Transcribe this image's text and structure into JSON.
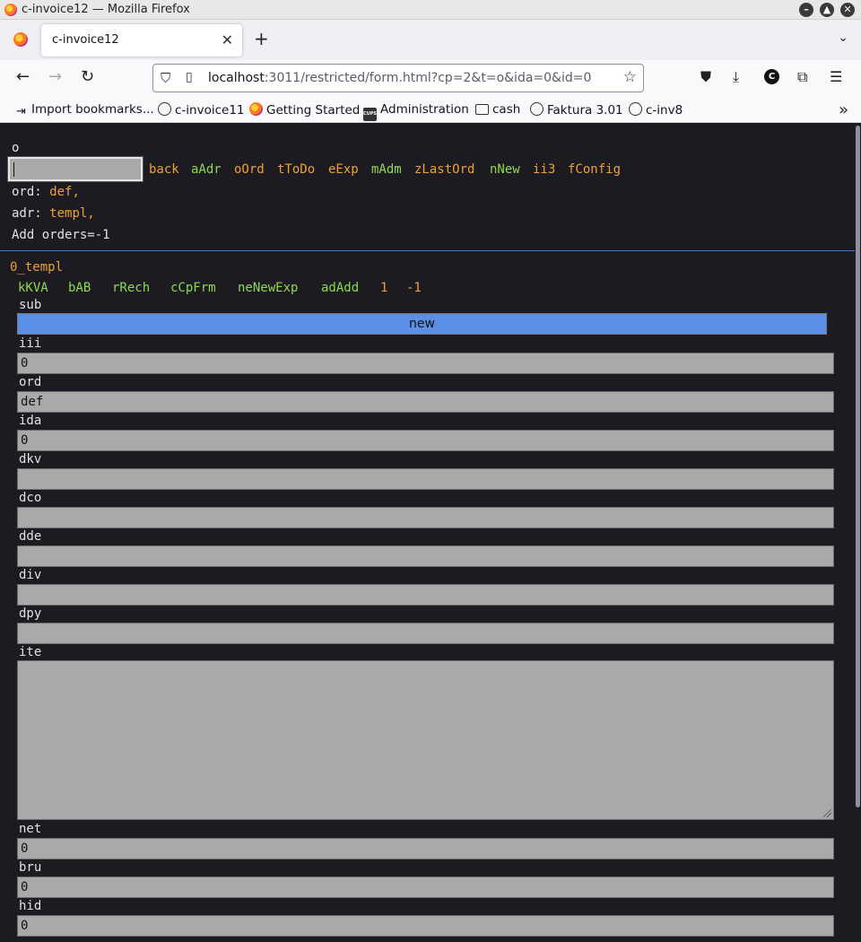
{
  "window": {
    "title": "c-invoice12 — Mozilla Firefox",
    "controls": [
      "minimize",
      "maximize",
      "close"
    ]
  },
  "tabs": {
    "active_title": "c-invoice12",
    "new_tab": "+",
    "list_all": "⌄"
  },
  "nav": {
    "url_host": "localhost",
    "url_rest": ":3011/restricted/form.html?cp=2&t=o&ida=0&id=0",
    "account_initial": "C"
  },
  "bookmarks": [
    {
      "label": "Import bookmarks...",
      "icon": "import-icon"
    },
    {
      "label": "c-invoice11",
      "icon": "globe-icon"
    },
    {
      "label": "Getting Started",
      "icon": "firefox-icon"
    },
    {
      "label": "Administration",
      "icon": "cups-icon"
    },
    {
      "label": "cash",
      "icon": "folder-icon"
    },
    {
      "label": "Faktura 3.01",
      "icon": "globe-icon"
    },
    {
      "label": "c-inv8",
      "icon": "globe-icon"
    }
  ],
  "page": {
    "mode": "o",
    "command_value": "",
    "nav_links": [
      {
        "label": "back",
        "color": "#f0a030"
      },
      {
        "label": "aAdr",
        "color": "#8fd94a"
      },
      {
        "label": "oOrd",
        "color": "#f0a030"
      },
      {
        "label": "tToDo",
        "color": "#f0a030"
      },
      {
        "label": "eExp",
        "color": "#f0a030"
      },
      {
        "label": "mAdm",
        "color": "#8fd94a"
      },
      {
        "label": "zLastOrd",
        "color": "#f0a030"
      },
      {
        "label": "nNew",
        "color": "#8fd94a"
      },
      {
        "label": "ii3",
        "color": "#f0a030"
      },
      {
        "label": "fConfig",
        "color": "#f0a030"
      }
    ],
    "ord_label": "ord:",
    "ord_value": "def,",
    "adr_label": "adr:",
    "adr_value": "templ,",
    "add_orders": "Add orders=-1",
    "record_title": "0_templ",
    "sub_links": [
      {
        "label": "kKVA",
        "color": "#8fd94a"
      },
      {
        "label": "bAB",
        "color": "#8fd94a"
      },
      {
        "label": "rRech",
        "color": "#8fd94a"
      },
      {
        "label": "cCpFrm",
        "color": "#8fd94a"
      },
      {
        "label": "neNewExp",
        "color": "#8fd94a"
      },
      {
        "label": "adAdd",
        "color": "#8fd94a"
      },
      {
        "label": "1",
        "color": "#f0a030"
      },
      {
        "label": "-1",
        "color": "#f0a030"
      }
    ],
    "form": {
      "sub_label": "sub",
      "sub_button": "new",
      "fields": [
        {
          "label": "iii",
          "value": "0"
        },
        {
          "label": "ord",
          "value": "def"
        },
        {
          "label": "ida",
          "value": "0"
        },
        {
          "label": "dkv",
          "value": ""
        },
        {
          "label": "dco",
          "value": ""
        },
        {
          "label": "dde",
          "value": ""
        },
        {
          "label": "div",
          "value": ""
        },
        {
          "label": "dpy",
          "value": ""
        }
      ],
      "ite_label": "ite",
      "ite_value": "",
      "fields_after": [
        {
          "label": "net",
          "value": "0"
        },
        {
          "label": "bru",
          "value": "0"
        },
        {
          "label": "hid",
          "value": "0"
        }
      ]
    }
  }
}
